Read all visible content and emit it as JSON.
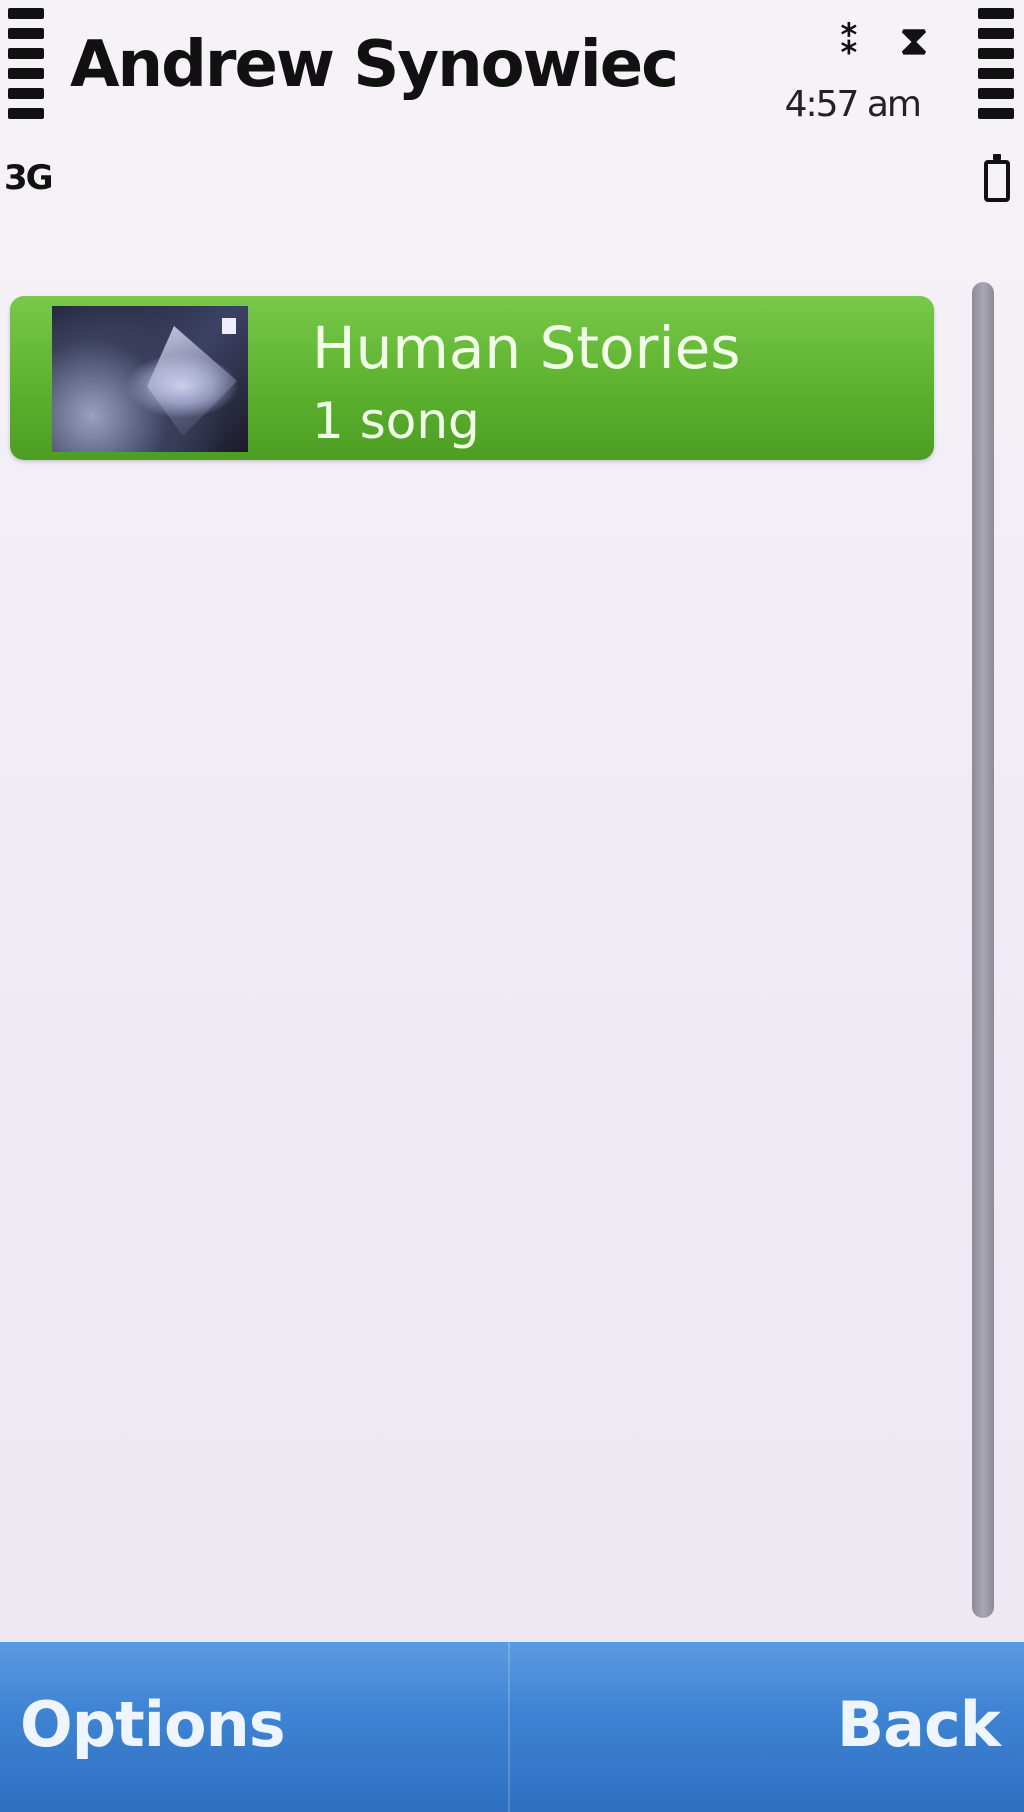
{
  "status": {
    "network": "3G",
    "clock": "4:57 am",
    "indicators": [
      "bluetooth-icon",
      "hourglass-icon"
    ]
  },
  "header": {
    "title": "Andrew Synowiec"
  },
  "list": {
    "items": [
      {
        "title": "Human Stories",
        "subtitle": "1 song",
        "art": "album-art-image"
      }
    ]
  },
  "softkeys": {
    "left": "Options",
    "right": "Back"
  },
  "colors": {
    "highlight": "#5fb431",
    "softkey_bar": "#3f84d4",
    "background": "#f3eff6"
  }
}
